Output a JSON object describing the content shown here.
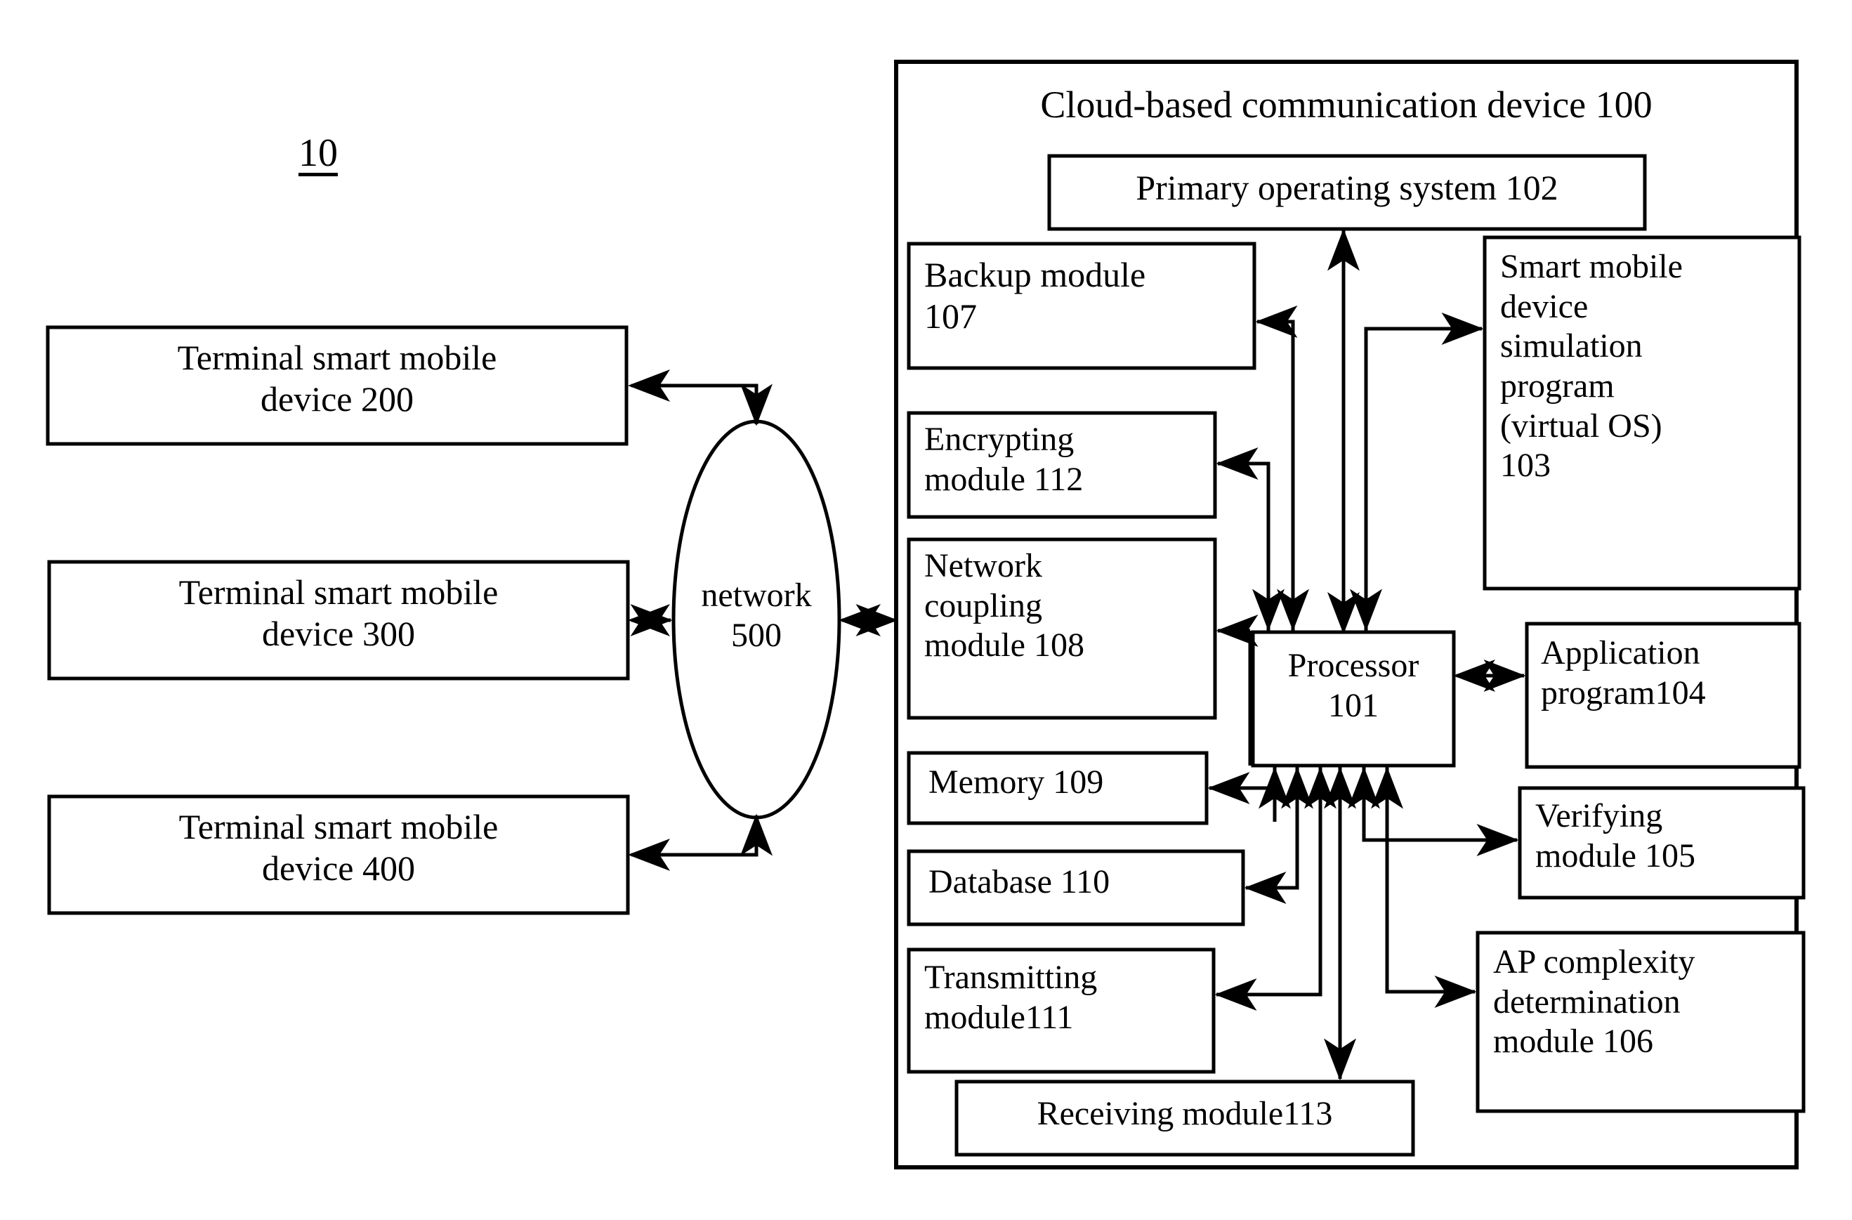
{
  "figure": {
    "number_label": "10"
  },
  "container": {
    "title": "Cloud-based communication device 100"
  },
  "terminals": [
    {
      "id": "device-200",
      "label": "Terminal smart mobile\ndevice 200"
    },
    {
      "id": "device-300",
      "label": "Terminal smart mobile\ndevice 300"
    },
    {
      "id": "device-400",
      "label": "Terminal smart mobile\ndevice 400"
    }
  ],
  "network": {
    "label": "network\n500"
  },
  "modules": {
    "primary_os": "Primary operating system 102",
    "backup": "Backup module\n107",
    "encrypting": "Encrypting\nmodule 112",
    "network_coupling": "Network\ncoupling\nmodule 108",
    "memory": "Memory 109",
    "database": "Database 110",
    "transmitting": "Transmitting\nmodule111",
    "receiving": "Receiving module113",
    "processor": "Processor\n101",
    "simulation": "Smart mobile\ndevice\nsimulation\nprogram\n(virtual OS)\n103",
    "application": "Application\nprogram104",
    "verifying": "Verifying\nmodule 105",
    "ap_complexity": "AP complexity\ndetermination\nmodule 106"
  },
  "colors": {
    "stroke": "#000000",
    "fill": "#ffffff"
  }
}
